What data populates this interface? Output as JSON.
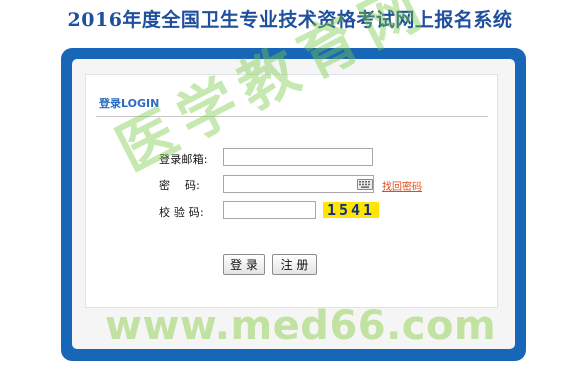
{
  "page": {
    "title": "2016年度全国卫生专业技术资格考试网上报名系统"
  },
  "login": {
    "section_title": "登录LOGIN",
    "email_label": "登录邮箱:",
    "email_value": "",
    "password_label": "密    码:",
    "password_value": "",
    "keyboard_icon": "keyboard-icon",
    "forgot_password_link": "找回密码",
    "captcha_label": "校 验 码:",
    "captcha_value": "",
    "captcha_code": "1541",
    "login_button": "登 录",
    "register_button": "注 册"
  },
  "watermark": {
    "text": "医学教育网",
    "url": "www.med66.com"
  },
  "colors": {
    "title": "#1f4f9e",
    "frame": "#1866b7",
    "section_title": "#2b6bc1",
    "forgot_link": "#e64a19",
    "captcha_bg": "#ffe500",
    "captcha_text": "#0b2f8a"
  }
}
